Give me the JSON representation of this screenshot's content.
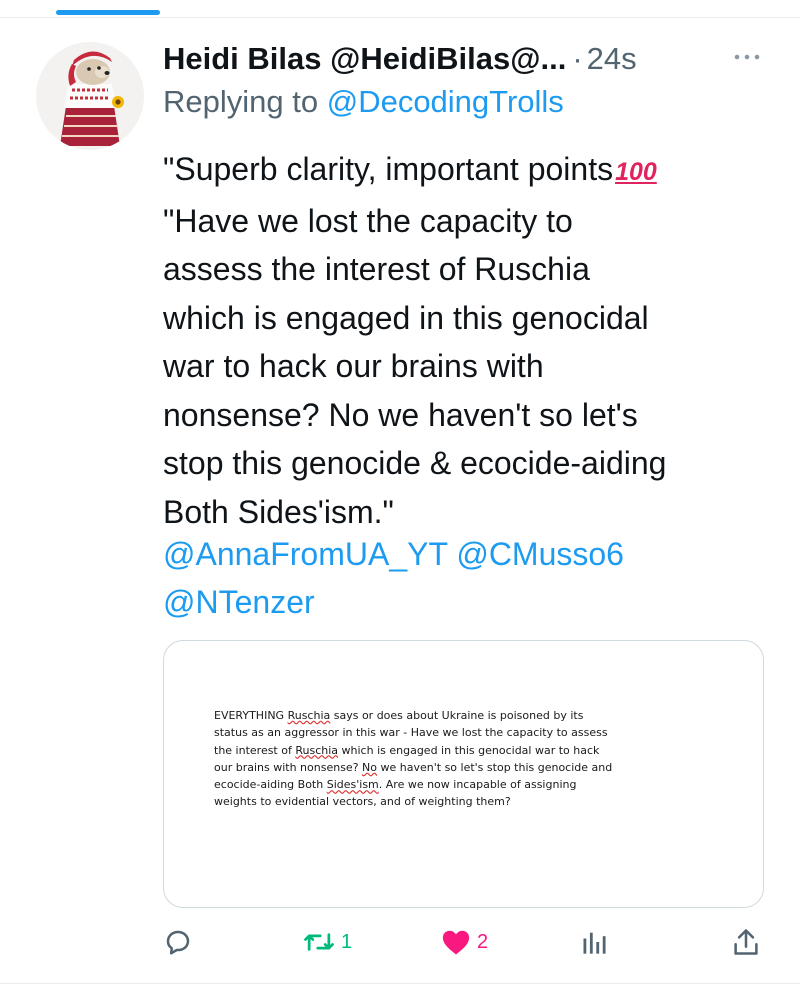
{
  "author": {
    "display_name": "Heidi Bilas",
    "handle": "@HeidiBilas@...",
    "separator": "·",
    "timestamp": "24s"
  },
  "reply": {
    "prefix": "Replying to",
    "handle": "@DecodingTrolls"
  },
  "tweet": {
    "lines": [
      "\"Superb clarity, important points",
      "\"Have we lost the capacity to",
      "assess the interest of Ruschia",
      "which is engaged in this genocidal",
      "war to hack our brains with",
      "nonsense? No we haven't so let's",
      "stop this genocide & ecocide-aiding",
      "Both Sides'ism.\""
    ],
    "emoji": "100",
    "mentions": [
      "@AnnaFromUA_YT",
      "@CMusso6",
      "@NTenzer"
    ]
  },
  "media": {
    "doc_lines": [
      "EVERYTHING Ruschia says or does about Ukraine is poisoned by its",
      "status as an aggressor in this war - Have we lost the capacity to assess",
      "the interest of Ruschia which is engaged in this genocidal war to hack",
      "our brains with nonsense? No we haven't so let's stop this genocide and",
      "ecocide-aiding Both Sides'ism. Are we now incapable of assigning",
      "weights to evidential vectors, and of weighting them?"
    ]
  },
  "actions": {
    "reply_count": "",
    "retweet_count": "1",
    "like_count": "2"
  },
  "colors": {
    "accent": "#1d9bf0",
    "retweet": "#00ba7c",
    "like": "#f91880",
    "secondary_text": "#536471"
  },
  "icons": [
    "reply-icon",
    "retweet-icon",
    "heart-icon",
    "analytics-icon",
    "share-icon",
    "more-icon"
  ]
}
